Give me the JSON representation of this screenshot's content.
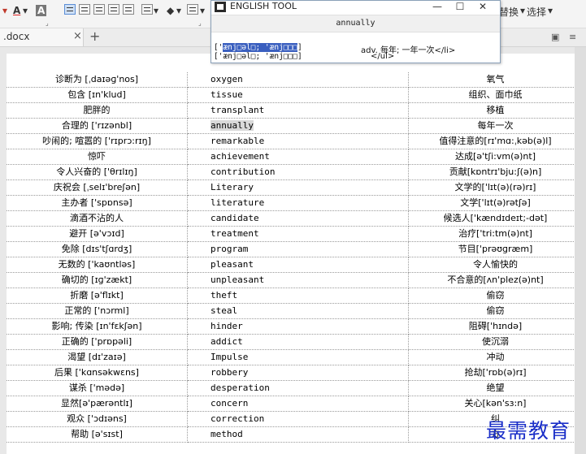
{
  "ribbon": {
    "font_color_icon": "A",
    "char_shade_icon": "A",
    "right_labels": [
      "替换",
      "选择"
    ]
  },
  "tab": {
    "doc_name": ".docx",
    "close_glyph": "×",
    "add_glyph": "+"
  },
  "popup": {
    "title": "ENGLISH TOOL",
    "input_value": "annually",
    "phonetic1_sel": "ænj□əl□; 'ænj□□□",
    "phonetic1_prefix": "['",
    "phonetic1_suffix": "]",
    "phonetic2": "['ænj□əl□; 'ænj□□□]",
    "definition": "adv. 每年; 一年一次</li>",
    "closing_tag": "</ul>",
    "minimize": "—",
    "maximize": "☐",
    "close": "✕"
  },
  "rows": [
    {
      "zh": "诊断为 [ˌdaɪəɡ'nos]",
      "en": "oxygen",
      "meaning": "氧气"
    },
    {
      "zh": "包含 [ɪn'klud]",
      "en": "tissue",
      "meaning": "组织、面巾纸"
    },
    {
      "zh": "肥胖的",
      "en": "transplant",
      "meaning": "移植"
    },
    {
      "zh": "合理的 ['rɪzənbl]",
      "en": "annually",
      "meaning": "每年一次"
    },
    {
      "zh": "吵闹的; 喧嚣的 ['rɪprɔ:rɪŋ]",
      "en": "remarkable",
      "meaning": "值得注意的[rɪ'mɑ:ˌkəb(ə)l]"
    },
    {
      "zh": "惊吓",
      "en": "achievement",
      "meaning": "达成[ə'tʃi:vm(ə)nt]"
    },
    {
      "zh": "令人兴奋的 ['θrɪlɪŋ]",
      "en": "contribution",
      "meaning": "贡献[kɒntrɪ'bju:ʃ(ə)n]"
    },
    {
      "zh": "庆祝会 [ˌselɪ'breʃən]",
      "en": "Literary",
      "meaning": "文学的['lɪt(ə)(rə)rɪ]"
    },
    {
      "zh": "主办者 ['spɒnsə]",
      "en": "literature",
      "meaning": "文学['lɪt(ə)rətʃə]"
    },
    {
      "zh": "滴酒不沾的人",
      "en": "candidate",
      "meaning": "候选人['kændɪdeɪt;-dət]"
    },
    {
      "zh": "避开 [ə'vɔɪd]",
      "en": "treatment",
      "meaning": "治疗['tri:tm(ə)nt]"
    },
    {
      "zh": "免除 [dɪs'tʃɑrdʒ]",
      "en": "program",
      "meaning": "节目['prəʊɡræm]"
    },
    {
      "zh": "无数的 ['kaʊntləs]",
      "en": "pleasant",
      "meaning": "令人愉快的"
    },
    {
      "zh": "确切的 [ɪɡ'zækt]",
      "en": "unpleasant",
      "meaning": "不合意的[ʌn'plez(ə)nt]"
    },
    {
      "zh": "折磨 [ə'flɪkt]",
      "en": "theft",
      "meaning": "偷窃"
    },
    {
      "zh": "正常的 ['nɔrml]",
      "en": "steal",
      "meaning": "偷窃"
    },
    {
      "zh": "影响; 传染 [ɪn'fɛkʃən]",
      "en": "hinder",
      "meaning": "阻碍['hɪndə]"
    },
    {
      "zh": "正确的 ['prɒpəli]",
      "en": "addict",
      "meaning": "使沉溺"
    },
    {
      "zh": "渴望 [dɪ'zaɪə]",
      "en": "Impulse",
      "meaning": "冲动"
    },
    {
      "zh": "后果 ['kɑnsəkwɛns]",
      "en": "robbery",
      "meaning": "抢劫['rɒb(ə)rɪ]"
    },
    {
      "zh": "谋杀 ['mədə]",
      "en": "desperation",
      "meaning": "绝望"
    },
    {
      "zh": "显然[ə'pærəntlɪ]",
      "en": "concern",
      "meaning": "关心[kən'sɜ:n]"
    },
    {
      "zh": "观众 ['ɔdɪəns]",
      "en": "correction",
      "meaning": "纠"
    },
    {
      "zh": "帮助 [ə'sɪst]",
      "en": "method",
      "meaning": "方"
    }
  ],
  "watermark": "最需教育"
}
